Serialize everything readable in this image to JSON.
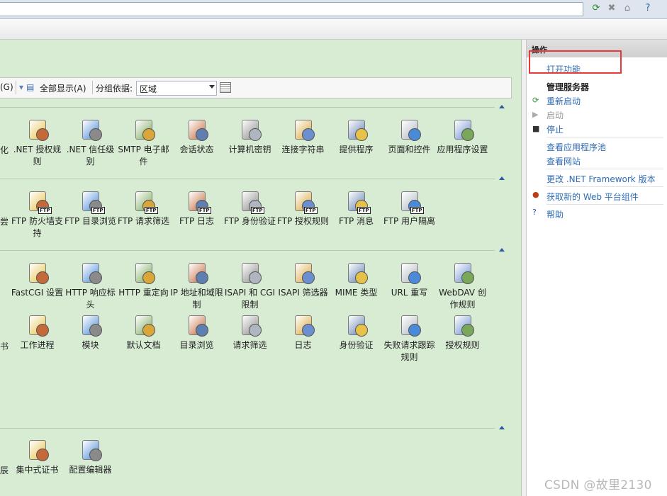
{
  "toolbar": {
    "icons": [
      "refresh-green-icon",
      "stop-icon",
      "home-icon",
      "help-icon"
    ]
  },
  "filter": {
    "shortcut_g": "(G)",
    "show_all": "全部显示(A)",
    "group_by_label": "分组依据:",
    "group_by_value": "区域"
  },
  "groups": [
    {
      "cut_label": "化",
      "items": [
        {
          "label": ".NET 授权规则",
          "icon": "lock-icon"
        },
        {
          "label": ".NET 信任级别",
          "icon": "globe-check-icon"
        },
        {
          "label": "SMTP 电子邮件",
          "icon": "mail-icon"
        },
        {
          "label": "会话状态",
          "icon": "user-session-icon"
        },
        {
          "label": "计算机密钥",
          "icon": "server-key-icon"
        },
        {
          "label": "连接字符串",
          "icon": "database-icon"
        },
        {
          "label": "提供程序",
          "icon": "provider-icon"
        },
        {
          "label": "页面和控件",
          "icon": "page-controls-icon"
        },
        {
          "label": "应用程序设置",
          "icon": "app-settings-icon"
        }
      ]
    },
    {
      "cut_label": "尝",
      "items": [
        {
          "label": "FTP 防火墙支持",
          "icon": "firewall-icon"
        },
        {
          "label": "FTP 目录浏览",
          "icon": "directory-browse-icon"
        },
        {
          "label": "FTP 请求筛选",
          "icon": "request-filter-icon"
        },
        {
          "label": "FTP 日志",
          "icon": "log-icon"
        },
        {
          "label": "FTP 身份验证",
          "icon": "auth-icon"
        },
        {
          "label": "FTP 授权规则",
          "icon": "key-icon"
        },
        {
          "label": "FTP 消息",
          "icon": "message-icon"
        },
        {
          "label": "FTP 用户隔离",
          "icon": "user-isolation-icon"
        }
      ]
    },
    {
      "cut_label": "书",
      "items": [
        {
          "label": "FastCGI 设置",
          "icon": "fastcgi-icon"
        },
        {
          "label": "HTTP 响应标头",
          "icon": "response-header-icon"
        },
        {
          "label": "HTTP 重定向",
          "icon": "redirect-icon"
        },
        {
          "label": "IP 地址和域限制",
          "icon": "ip-restrict-icon"
        },
        {
          "label": "ISAPI 和 CGI 限制",
          "icon": "isapi-cgi-icon"
        },
        {
          "label": "ISAPI 筛选器",
          "icon": "isapi-filter-icon"
        },
        {
          "label": "MIME 类型",
          "icon": "mime-icon"
        },
        {
          "label": "URL 重写",
          "icon": "url-rewrite-icon"
        },
        {
          "label": "WebDAV 创作规则",
          "icon": "webdav-icon"
        },
        {
          "label": "工作进程",
          "icon": "worker-process-icon"
        },
        {
          "label": "模块",
          "icon": "modules-icon"
        },
        {
          "label": "默认文档",
          "icon": "default-doc-icon"
        },
        {
          "label": "目录浏览",
          "icon": "dir-browse-icon"
        },
        {
          "label": "请求筛选",
          "icon": "req-filter-icon"
        },
        {
          "label": "日志",
          "icon": "logging-icon"
        },
        {
          "label": "身份验证",
          "icon": "authentication-icon"
        },
        {
          "label": "失败请求跟踪规则",
          "icon": "failed-trace-icon"
        },
        {
          "label": "授权规则",
          "icon": "authorization-icon"
        }
      ]
    },
    {
      "cut_label": "辰",
      "items": [
        {
          "label": "集中式证书",
          "icon": "certificate-icon"
        },
        {
          "label": "配置编辑器",
          "icon": "config-editor-icon"
        }
      ]
    }
  ],
  "actions": {
    "title": "操作",
    "open_feature": "打开功能",
    "manage_server": "管理服务器",
    "restart": "重新启动",
    "start": "启动",
    "stop": "停止",
    "view_app_pools": "查看应用程序池",
    "view_sites": "查看网站",
    "change_net_version": "更改 .NET Framework 版本",
    "get_web_components": "获取新的 Web 平台组件",
    "help": "帮助"
  },
  "watermark": "CSDN @故里2130",
  "colors": {
    "main_bg": "#d8ecd4",
    "link": "#2f6cb5",
    "highlight": "#e5393a"
  }
}
